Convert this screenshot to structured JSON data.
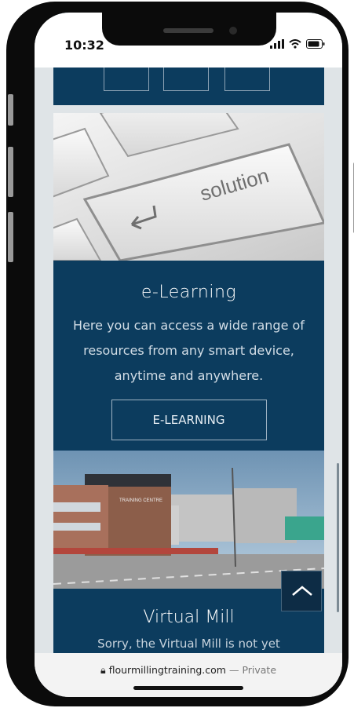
{
  "status_bar": {
    "time": "10:32"
  },
  "elearning_card": {
    "photo_caption": "solution",
    "title": "e-Learning",
    "description": "Here you can access a wide range of resources from any smart device, anytime and anywhere.",
    "button_label": "E-LEARNING"
  },
  "mill_photo": {
    "sign_text": "TRAINING CENTRE"
  },
  "virtual_mill_card": {
    "title": "Virtual Mill",
    "description_partial": "Sorry, the Virtual Mill is not yet"
  },
  "browser": {
    "domain": "flourmillingtraining.com",
    "mode": "— Private"
  },
  "icons": {
    "signal": "signal-icon",
    "wifi": "wifi-icon",
    "battery": "battery-icon",
    "lock": "lock-icon",
    "scroll_top": "chevron-up-icon"
  },
  "colors": {
    "card_blue": "#0c3c5e",
    "scroll_button": "#0d2c45"
  }
}
